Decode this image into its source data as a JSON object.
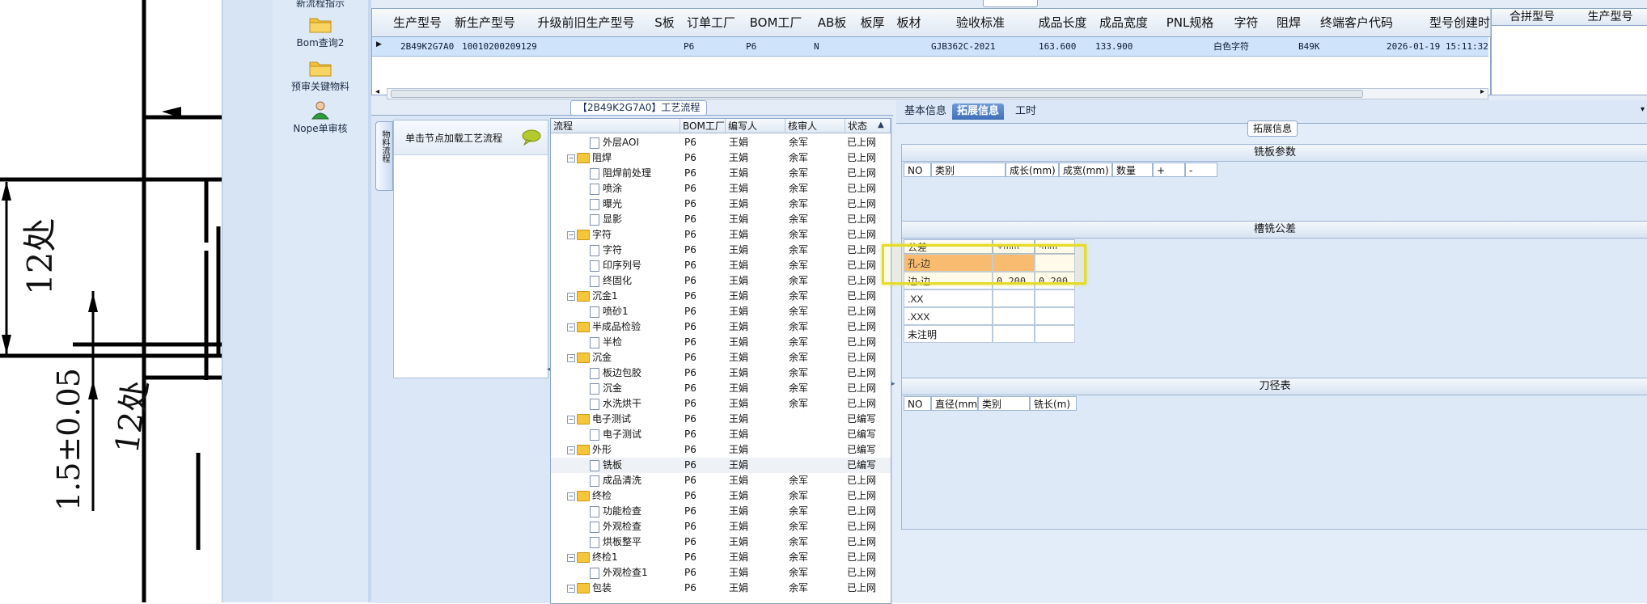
{
  "nav": {
    "items": [
      {
        "label": "新流程指示"
      },
      {
        "label": "Bom查询2"
      },
      {
        "label": "预审关键物料"
      },
      {
        "label": "Nope单审核"
      }
    ]
  },
  "cad": {
    "labels": [
      "12处",
      "12处",
      "1.5±0.05"
    ]
  },
  "top_grid": {
    "columns": [
      "生产型号",
      "新生产型号",
      "升级前旧生产型号",
      "S板",
      "订单工厂",
      "BOM工厂",
      "AB板",
      "板厚",
      "板材",
      "验收标准",
      "成品长度",
      "成品宽度",
      "PNL规格",
      "字符",
      "阻焊",
      "终端客户代码",
      "型号创建时"
    ],
    "row": {
      "生产型号": "2B49K2G7A0",
      "新生产型号": "10010200209129",
      "升级前旧生产型号": "",
      "S板": "",
      "订单工厂": "P6",
      "BOM工厂": "P6",
      "AB板": "N",
      "板厚": "",
      "板材": "",
      "验收标准": "GJB362C-2021",
      "成品长度": "163.600",
      "成品宽度": "133.900",
      "PNL规格": "",
      "字符": "白色字符",
      "阻焊": "",
      "终端客户代码": "B49K",
      "型号创建时": "2026-01-19 15:11:32"
    },
    "right_columns": [
      "合拼型号",
      "生产型号"
    ]
  },
  "flow": {
    "title": "【2B49K2G7A0】工艺流程",
    "vertical_tab": "物料流程",
    "hint": "单击节点加载工艺流程",
    "tree_columns": [
      "流程",
      "BOM工厂",
      "编写人",
      "核审人",
      "状态"
    ],
    "rows": [
      {
        "level": 1,
        "type": "doc",
        "name": "外层AOI",
        "bom": "P6",
        "writer": "王娟",
        "reviewer": "余军",
        "status": "已上网"
      },
      {
        "level": 0,
        "type": "folder",
        "name": "阻焊",
        "bom": "P6",
        "writer": "王娟",
        "reviewer": "余军",
        "status": "已上网"
      },
      {
        "level": 1,
        "type": "doc",
        "name": "阻焊前处理",
        "bom": "P6",
        "writer": "王娟",
        "reviewer": "余军",
        "status": "已上网"
      },
      {
        "level": 1,
        "type": "doc",
        "name": "喷涂",
        "bom": "P6",
        "writer": "王娟",
        "reviewer": "余军",
        "status": "已上网"
      },
      {
        "level": 1,
        "type": "doc",
        "name": "曝光",
        "bom": "P6",
        "writer": "王娟",
        "reviewer": "余军",
        "status": "已上网"
      },
      {
        "level": 1,
        "type": "doc",
        "name": "显影",
        "bom": "P6",
        "writer": "王娟",
        "reviewer": "余军",
        "status": "已上网"
      },
      {
        "level": 0,
        "type": "folder",
        "name": "字符",
        "bom": "P6",
        "writer": "王娟",
        "reviewer": "余军",
        "status": "已上网"
      },
      {
        "level": 1,
        "type": "doc",
        "name": "字符",
        "bom": "P6",
        "writer": "王娟",
        "reviewer": "余军",
        "status": "已上网"
      },
      {
        "level": 1,
        "type": "doc",
        "name": "印序列号",
        "bom": "P6",
        "writer": "王娟",
        "reviewer": "余军",
        "status": "已上网"
      },
      {
        "level": 1,
        "type": "doc",
        "name": "终固化",
        "bom": "P6",
        "writer": "王娟",
        "reviewer": "余军",
        "status": "已上网"
      },
      {
        "level": 0,
        "type": "folder",
        "name": "沉金1",
        "bom": "P6",
        "writer": "王娟",
        "reviewer": "余军",
        "status": "已上网"
      },
      {
        "level": 1,
        "type": "doc",
        "name": "喷砂1",
        "bom": "P6",
        "writer": "王娟",
        "reviewer": "余军",
        "status": "已上网"
      },
      {
        "level": 0,
        "type": "folder",
        "name": "半成品检验",
        "bom": "P6",
        "writer": "王娟",
        "reviewer": "余军",
        "status": "已上网"
      },
      {
        "level": 1,
        "type": "doc",
        "name": "半检",
        "bom": "P6",
        "writer": "王娟",
        "reviewer": "余军",
        "status": "已上网"
      },
      {
        "level": 0,
        "type": "folder",
        "name": "沉金",
        "bom": "P6",
        "writer": "王娟",
        "reviewer": "余军",
        "status": "已上网"
      },
      {
        "level": 1,
        "type": "doc",
        "name": "板边包胶",
        "bom": "P6",
        "writer": "王娟",
        "reviewer": "余军",
        "status": "已上网"
      },
      {
        "level": 1,
        "type": "doc",
        "name": "沉金",
        "bom": "P6",
        "writer": "王娟",
        "reviewer": "余军",
        "status": "已上网"
      },
      {
        "level": 1,
        "type": "doc",
        "name": "水洗烘干",
        "bom": "P6",
        "writer": "王娟",
        "reviewer": "余军",
        "status": "已上网"
      },
      {
        "level": 0,
        "type": "folder",
        "name": "电子测试",
        "bom": "P6",
        "writer": "王娟",
        "reviewer": "",
        "status": "已编写"
      },
      {
        "level": 1,
        "type": "doc",
        "name": "电子测试",
        "bom": "P6",
        "writer": "王娟",
        "reviewer": "",
        "status": "已编写"
      },
      {
        "level": 0,
        "type": "folder",
        "name": "外形",
        "bom": "P6",
        "writer": "王娟",
        "reviewer": "",
        "status": "已编写"
      },
      {
        "level": 1,
        "type": "doc",
        "name": "铣板",
        "bom": "P6",
        "writer": "王娟",
        "reviewer": "",
        "status": "已编写"
      },
      {
        "level": 1,
        "type": "doc",
        "name": "成品清洗",
        "bom": "P6",
        "writer": "王娟",
        "reviewer": "余军",
        "status": "已上网"
      },
      {
        "level": 0,
        "type": "folder",
        "name": "终检",
        "bom": "P6",
        "writer": "王娟",
        "reviewer": "余军",
        "status": "已上网"
      },
      {
        "level": 1,
        "type": "doc",
        "name": "功能检查",
        "bom": "P6",
        "writer": "王娟",
        "reviewer": "余军",
        "status": "已上网"
      },
      {
        "level": 1,
        "type": "doc",
        "name": "外观检查",
        "bom": "P6",
        "writer": "王娟",
        "reviewer": "余军",
        "status": "已上网"
      },
      {
        "level": 1,
        "type": "doc",
        "name": "烘板整平",
        "bom": "P6",
        "writer": "王娟",
        "reviewer": "余军",
        "status": "已上网"
      },
      {
        "level": 0,
        "type": "folder",
        "name": "终检1",
        "bom": "P6",
        "writer": "王娟",
        "reviewer": "余军",
        "status": "已上网"
      },
      {
        "level": 1,
        "type": "doc",
        "name": "外观检查1",
        "bom": "P6",
        "writer": "王娟",
        "reviewer": "余军",
        "status": "已上网"
      },
      {
        "level": 0,
        "type": "folder",
        "name": "包装",
        "bom": "P6",
        "writer": "王娟",
        "reviewer": "余军",
        "status": "已上网"
      }
    ]
  },
  "info": {
    "tabs": [
      "基本信息",
      "拓展信息",
      "工时"
    ],
    "active_tab": 1,
    "group_title": "拓展信息",
    "mill_params": {
      "title": "铣板参数",
      "columns": [
        "NO",
        "类别",
        "成长(mm)",
        "成宽(mm)",
        "数量",
        "+",
        "-"
      ]
    },
    "slot_tolerance": {
      "title": "槽铣公差",
      "header": [
        "公差",
        "+mm",
        "-mm"
      ],
      "rows": [
        {
          "name": "孔-边",
          "plus": "",
          "minus": ""
        },
        {
          "name": "边-边",
          "plus": "0.200",
          "minus": "0.200"
        },
        {
          "name": ".XX",
          "plus": "",
          "minus": ""
        },
        {
          "name": ".XXX",
          "plus": "",
          "minus": ""
        },
        {
          "name": "未注明",
          "plus": "",
          "minus": ""
        }
      ]
    },
    "tool_table": {
      "title": "刀径表",
      "columns": [
        "NO",
        "直径(mm)",
        "类别",
        "铣长(m)"
      ]
    }
  },
  "colors": {
    "accent": "#3f6fb8",
    "highlight": "#e5dc2a",
    "selected_row": "#cfe3fb",
    "folder": "#f5c53a"
  }
}
